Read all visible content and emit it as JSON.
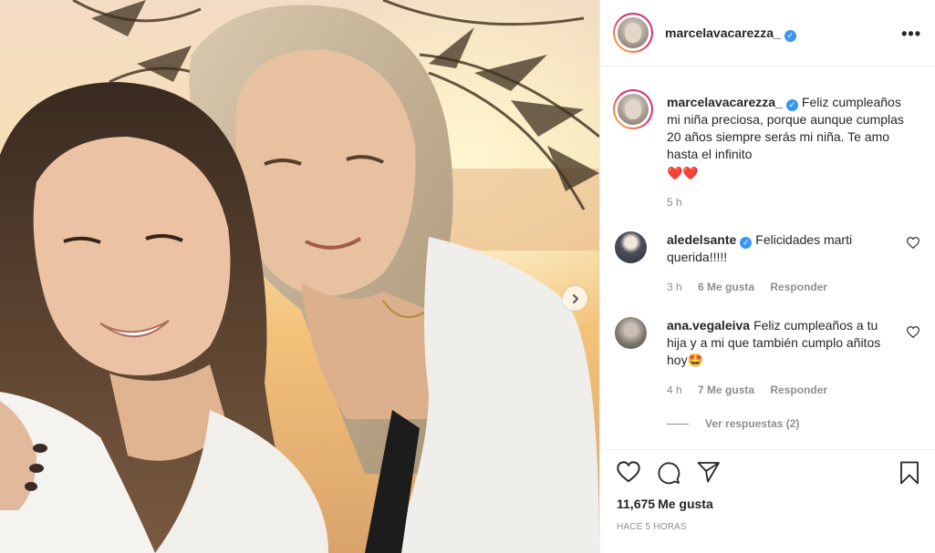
{
  "post": {
    "author": "marcelavacarezza_",
    "verified": true
  },
  "header": {
    "username": "marcelavacarezza_",
    "more_label": "•••"
  },
  "caption": {
    "username": "marcelavacarezza_",
    "text": "Feliz cumpleaños mi niña preciosa, porque aunque cumplas 20 años siempre serás mi niña. Te amo hasta el infinito",
    "emoji": "❤️❤️",
    "time": "5 h"
  },
  "comments": [
    {
      "username": "aledelsante",
      "verified": true,
      "text": "Felicidades marti querida!!!!!",
      "time": "3 h",
      "likes": "6 Me gusta",
      "reply": "Responder"
    },
    {
      "username": "ana.vegaleiva",
      "verified": false,
      "text": "Feliz cumpleaños a tu hija y a mi que también cumplo añitos hoy",
      "emoji": "🤩",
      "time": "4 h",
      "likes": "7 Me gusta",
      "reply": "Responder"
    }
  ],
  "view_replies": "Ver respuestas (2)",
  "footer": {
    "likes_count": "11,675",
    "likes_label": "Me gusta",
    "posted_ago": "HACE 5 HORAS"
  },
  "icons": {
    "like": "heart-icon",
    "comment": "comment-bubble-icon",
    "share": "paper-plane-icon",
    "save": "bookmark-icon",
    "next": "chevron-right-icon",
    "verified": "verified-badge-icon"
  },
  "colors": {
    "verified": "#3897f0",
    "muted": "#8e8e8e",
    "text": "#262626",
    "border": "#efefef"
  }
}
